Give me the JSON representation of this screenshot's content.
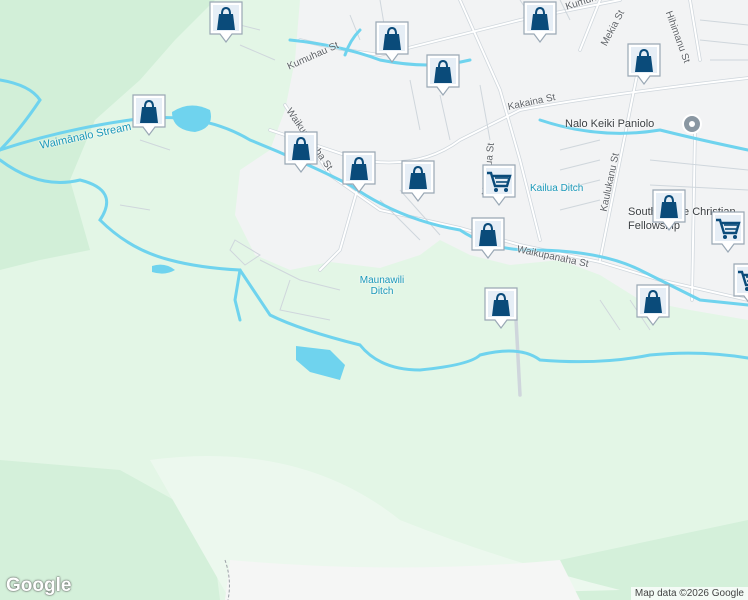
{
  "map": {
    "colors": {
      "land": "#e3f6e6",
      "forest": "#d2efd8",
      "urban": "#f2f3f4",
      "road": "#ffffff",
      "road_edge": "#cfd6dc",
      "water": "#6fd3ee",
      "marker": "#0a4b7a"
    },
    "street_labels": [
      "Kumuhau St",
      "Waikupanaha St",
      "Kakaina St",
      "Mahailua St",
      "Waikupanaha St",
      "Kaulukanu St",
      "Mekia St",
      "Hihimanu St",
      "Kumuniki St"
    ],
    "water_labels": [
      "Waimānalo Stream",
      "Kailua Ditch",
      "Maunawili Ditch"
    ],
    "poi_labels": {
      "nalo": "Nalo Keiki Paniolo",
      "church": "South Shore Christian Fellowship"
    },
    "markers": [
      {
        "type": "shopping-bag"
      },
      {
        "type": "shopping-bag"
      },
      {
        "type": "shopping-bag"
      },
      {
        "type": "shopping-bag"
      },
      {
        "type": "shopping-bag"
      },
      {
        "type": "shopping-bag"
      },
      {
        "type": "shopping-bag"
      },
      {
        "type": "shopping-bag"
      },
      {
        "type": "shopping-bag"
      },
      {
        "type": "shopping-cart"
      },
      {
        "type": "shopping-bag"
      },
      {
        "type": "shopping-bag"
      },
      {
        "type": "shopping-bag"
      },
      {
        "type": "shopping-bag"
      },
      {
        "type": "shopping-cart"
      },
      {
        "type": "shopping-cart"
      }
    ],
    "branding": "Google",
    "attribution": "Map data ©2026 Google"
  }
}
